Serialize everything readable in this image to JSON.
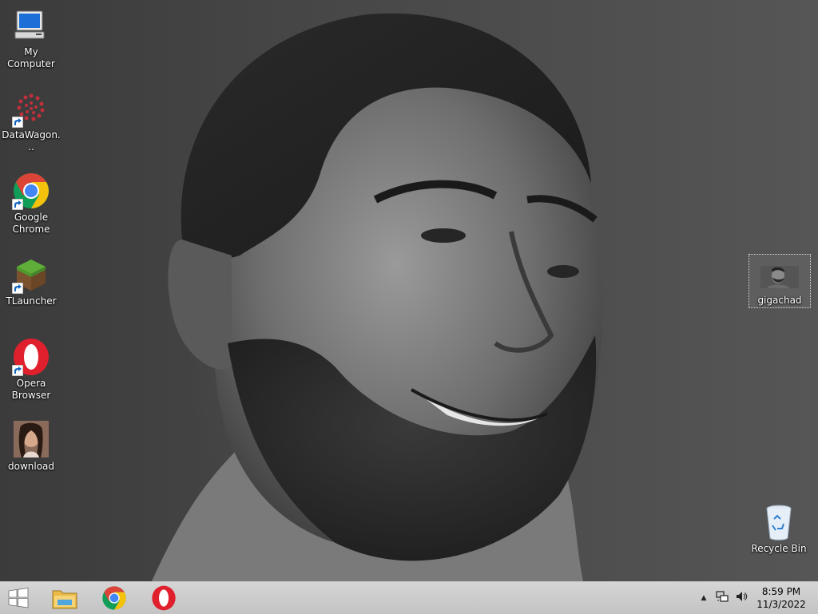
{
  "desktop": {
    "icons": [
      {
        "label": "My Computer"
      },
      {
        "label": "DataWagon..."
      },
      {
        "label": "Google Chrome"
      },
      {
        "label": "TLauncher"
      },
      {
        "label": "Opera Browser"
      },
      {
        "label": "download"
      },
      {
        "label": "gigachad"
      },
      {
        "label": "Recycle Bin"
      }
    ]
  },
  "taskbar": {
    "pinned": [
      "start-icon",
      "file-explorer-icon",
      "chrome-icon",
      "opera-icon"
    ],
    "tray": {
      "time": "8:59 PM",
      "date": "11/3/2022"
    }
  },
  "colors": {
    "chrome_red": "#db4437",
    "chrome_yellow": "#f4c20d",
    "chrome_green": "#0f9d58",
    "chrome_blue": "#4285f4",
    "opera_red": "#e0202c",
    "start_blue": "#ffffff"
  }
}
